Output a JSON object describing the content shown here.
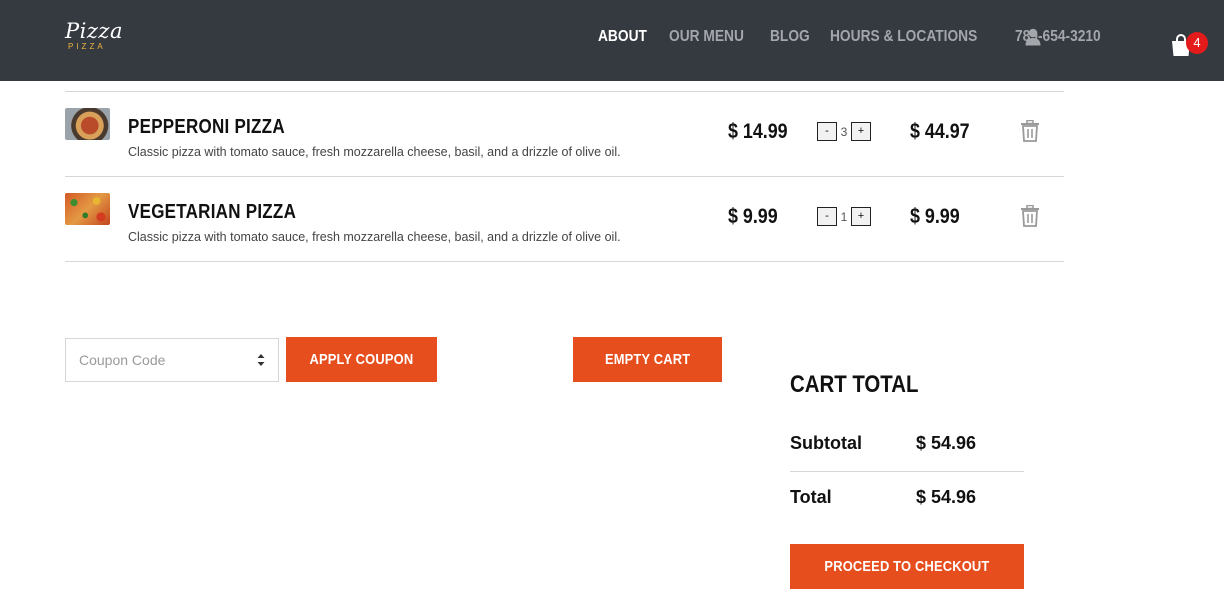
{
  "brand": {
    "name": "Pizza",
    "tagline": "PIZZA"
  },
  "nav": {
    "items": [
      {
        "label": "ABOUT",
        "active": true
      },
      {
        "label": "OUR MENU",
        "active": false
      },
      {
        "label": "BLOG",
        "active": false
      },
      {
        "label": "HOURS & LOCATIONS",
        "active": false
      }
    ],
    "phone": "789-654-3210",
    "user_icon": "user-icon",
    "cart_icon": "shopping-bag-icon",
    "cart_count": "4"
  },
  "cart": {
    "items": [
      {
        "name": "PEPPERONI PIZZA",
        "description": "Classic pizza with tomato sauce, fresh mozzarella cheese, basil, and a drizzle of olive oil.",
        "price": "$ 14.99",
        "quantity": "3",
        "minus": "-",
        "plus": "+",
        "line_total": "$ 44.97"
      },
      {
        "name": "VEGETARIAN PIZZA",
        "description": "Classic pizza with tomato sauce, fresh mozzarella cheese, basil, and a drizzle of olive oil.",
        "price": "$ 9.99",
        "quantity": "1",
        "minus": "-",
        "plus": "+",
        "line_total": "$ 9.99"
      }
    ]
  },
  "coupon": {
    "placeholder": "Coupon Code",
    "apply_label": "APPLY COUPON",
    "empty_label": "EMPTY CART"
  },
  "totals": {
    "title": "CART TOTAL",
    "subtotal_label": "Subtotal",
    "subtotal_value": "$ 54.96",
    "total_label": "Total",
    "total_value": "$ 54.96",
    "checkout_label": "PROCEED TO CHECKOUT"
  },
  "colors": {
    "header_bg": "#353940",
    "accent": "#e74e1e",
    "badge": "#e41b1b",
    "nav_inactive": "#a3a6ab",
    "logo_sub": "#f0b43c"
  }
}
